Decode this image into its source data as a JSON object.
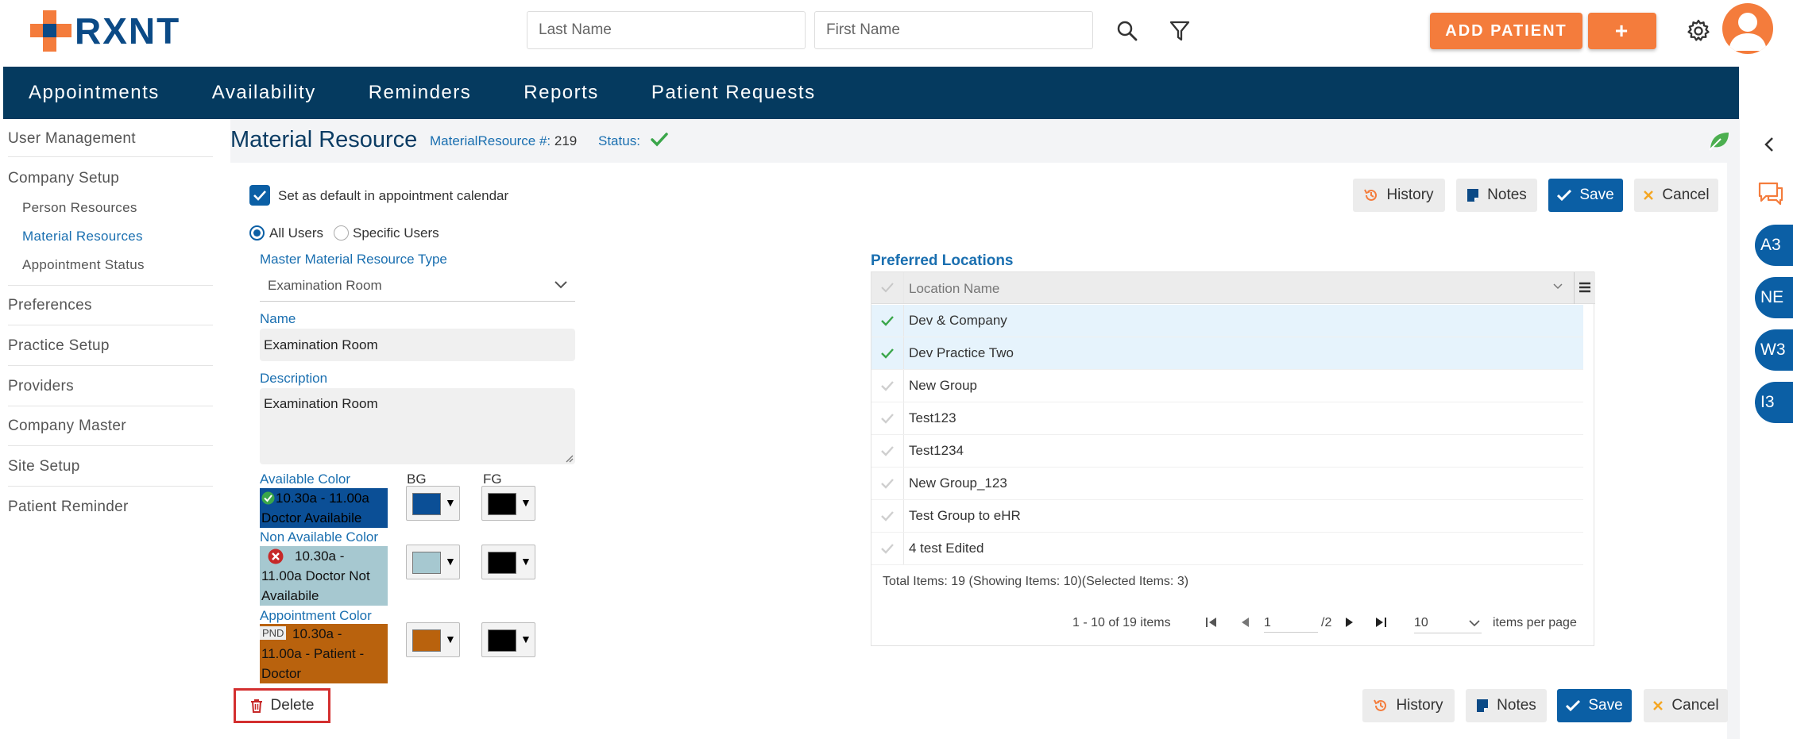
{
  "brand": {
    "name": "RXNT",
    "orange": "#f47c3c",
    "blue": "#0b4a86"
  },
  "header": {
    "last_name_placeholder": "Last Name",
    "first_name_placeholder": "First Name",
    "add_patient_label": "ADD PATIENT",
    "add_plus_label": "+"
  },
  "nav": {
    "items": [
      "Appointments",
      "Availability",
      "Reminders",
      "Reports",
      "Patient Requests"
    ]
  },
  "sidebar": {
    "user_management": "User Management",
    "company_setup": "Company Setup",
    "person_resources": "Person Resources",
    "material_resources": "Material Resources",
    "appointment_status": "Appointment Status",
    "preferences": "Preferences",
    "practice_setup": "Practice Setup",
    "providers": "Providers",
    "company_master": "Company Master",
    "site_setup": "Site Setup",
    "patient_reminder": "Patient Reminder"
  },
  "page": {
    "title": "Material Resource",
    "id_label": "MaterialResource #:",
    "id_value": "219",
    "status_label": "Status:"
  },
  "form": {
    "default_calendar_label": "Set as default in appointment calendar",
    "all_users_label": "All Users",
    "specific_users_label": "Specific Users",
    "master_type_label": "Master Material Resource Type",
    "master_type_value": "Examination Room",
    "name_label": "Name",
    "name_value": "Examination Room",
    "description_label": "Description",
    "description_value": "Examination Room",
    "available_color_label": "Available Color",
    "bg_label": "BG",
    "fg_label": "FG",
    "available_preview_line1": "10.30a - 11.00a",
    "available_preview_line2": "Doctor Availabile",
    "non_available_color_label": "Non Available Color",
    "non_available_preview_line1": "10.30a -",
    "non_available_preview_line2": "11.00a Doctor Not",
    "non_available_preview_line3": "Availabile",
    "appointment_color_label": "Appointment Color",
    "appointment_preview_badge": "PND",
    "appointment_preview_line1": "10.30a -",
    "appointment_preview_line2": "11.00a - Patient -",
    "appointment_preview_line3": "Doctor",
    "available_bg": "#0b4f96",
    "non_available_bg": "#a6c8d0",
    "appointment_bg": "#b9620d",
    "fg_color": "#000000"
  },
  "actions": {
    "history_label": "History",
    "notes_label": "Notes",
    "save_label": "Save",
    "cancel_label": "Cancel",
    "delete_label": "Delete"
  },
  "locations": {
    "title": "Preferred Locations",
    "column_header": "Location Name",
    "rows": [
      {
        "name": "Dev & Company",
        "selected": true
      },
      {
        "name": "Dev Practice Two",
        "selected": true
      },
      {
        "name": "New Group",
        "selected": false
      },
      {
        "name": "Test123",
        "selected": false
      },
      {
        "name": "Test1234",
        "selected": false
      },
      {
        "name": "New Group_123",
        "selected": false
      },
      {
        "name": "Test Group to eHR",
        "selected": false
      },
      {
        "name": "4 test Edited",
        "selected": false
      }
    ],
    "summary": "Total Items: 19 (Showing Items: 10)(Selected Items: 3)",
    "range_text": "1 - 10 of 19 items",
    "current_page": "1",
    "total_pages": "/2",
    "page_size": "10",
    "per_page_label": "items per page"
  },
  "right_rail": {
    "bubbles": [
      "A3",
      "NE",
      "W3",
      "I3"
    ]
  }
}
